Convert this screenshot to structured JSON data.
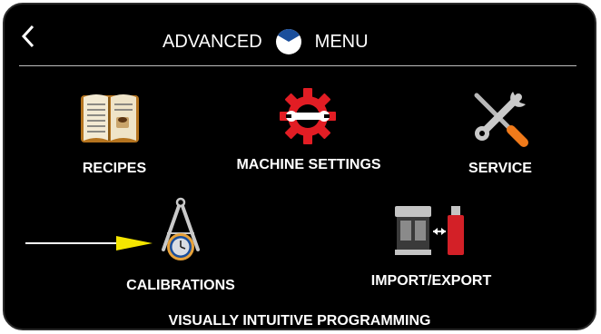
{
  "header": {
    "title_left": "ADVANCED",
    "title_right": "MENU",
    "back_icon": "chevron-left-icon",
    "logo_icon": "clock-logo-icon"
  },
  "tiles": [
    {
      "label": "RECIPES",
      "icon": "recipe-book-icon"
    },
    {
      "label": "MACHINE SETTINGS",
      "icon": "gear-wrench-icon"
    },
    {
      "label": "SERVICE",
      "icon": "wrench-screwdriver-icon"
    },
    {
      "label": "CALIBRATIONS",
      "icon": "compass-clock-icon"
    },
    {
      "label": "IMPORT/EXPORT",
      "icon": "machine-usb-transfer-icon"
    }
  ],
  "footer": {
    "text": "VISUALLY INTUITIVE PROGRAMMING"
  },
  "colors": {
    "screen_bg": "#000000",
    "text": "#ffffff",
    "gear_red": "#e21d24",
    "screwdriver_orange": "#f07a1a",
    "pointer_yellow": "#f5e600",
    "logo_blue": "#1b4f9c"
  }
}
